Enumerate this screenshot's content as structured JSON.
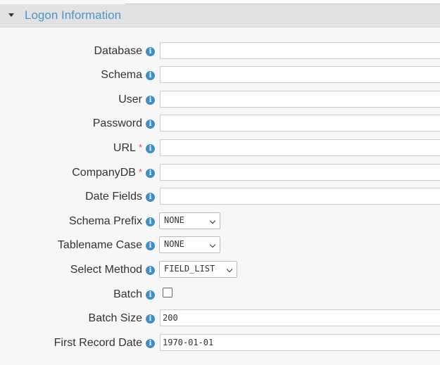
{
  "section": {
    "title": "Logon Information"
  },
  "fields": {
    "database": {
      "label": "Database",
      "value": ""
    },
    "schema": {
      "label": "Schema",
      "value": ""
    },
    "user": {
      "label": "User",
      "value": ""
    },
    "password": {
      "label": "Password",
      "value": ""
    },
    "url": {
      "label": "URL",
      "required": "*",
      "value": ""
    },
    "companydb": {
      "label": "CompanyDB",
      "required": "*",
      "value": ""
    },
    "date_fields": {
      "label": "Date Fields",
      "value": ""
    },
    "schema_prefix": {
      "label": "Schema Prefix",
      "value": "NONE"
    },
    "tablename_case": {
      "label": "Tablename Case",
      "value": "NONE"
    },
    "select_method": {
      "label": "Select Method",
      "value": "FIELD_LIST"
    },
    "batch": {
      "label": "Batch",
      "checked": false
    },
    "batch_size": {
      "label": "Batch Size",
      "value": "200"
    },
    "first_record_date": {
      "label": "First Record Date",
      "value": "1970-01-01"
    }
  },
  "icons": {
    "info": "info-icon",
    "collapse": "caret-down-icon"
  },
  "colors": {
    "accent": "#4a97c9",
    "info": "#3c8fc7",
    "required": "#d9534f",
    "header_bg": "#e2e2e2"
  }
}
